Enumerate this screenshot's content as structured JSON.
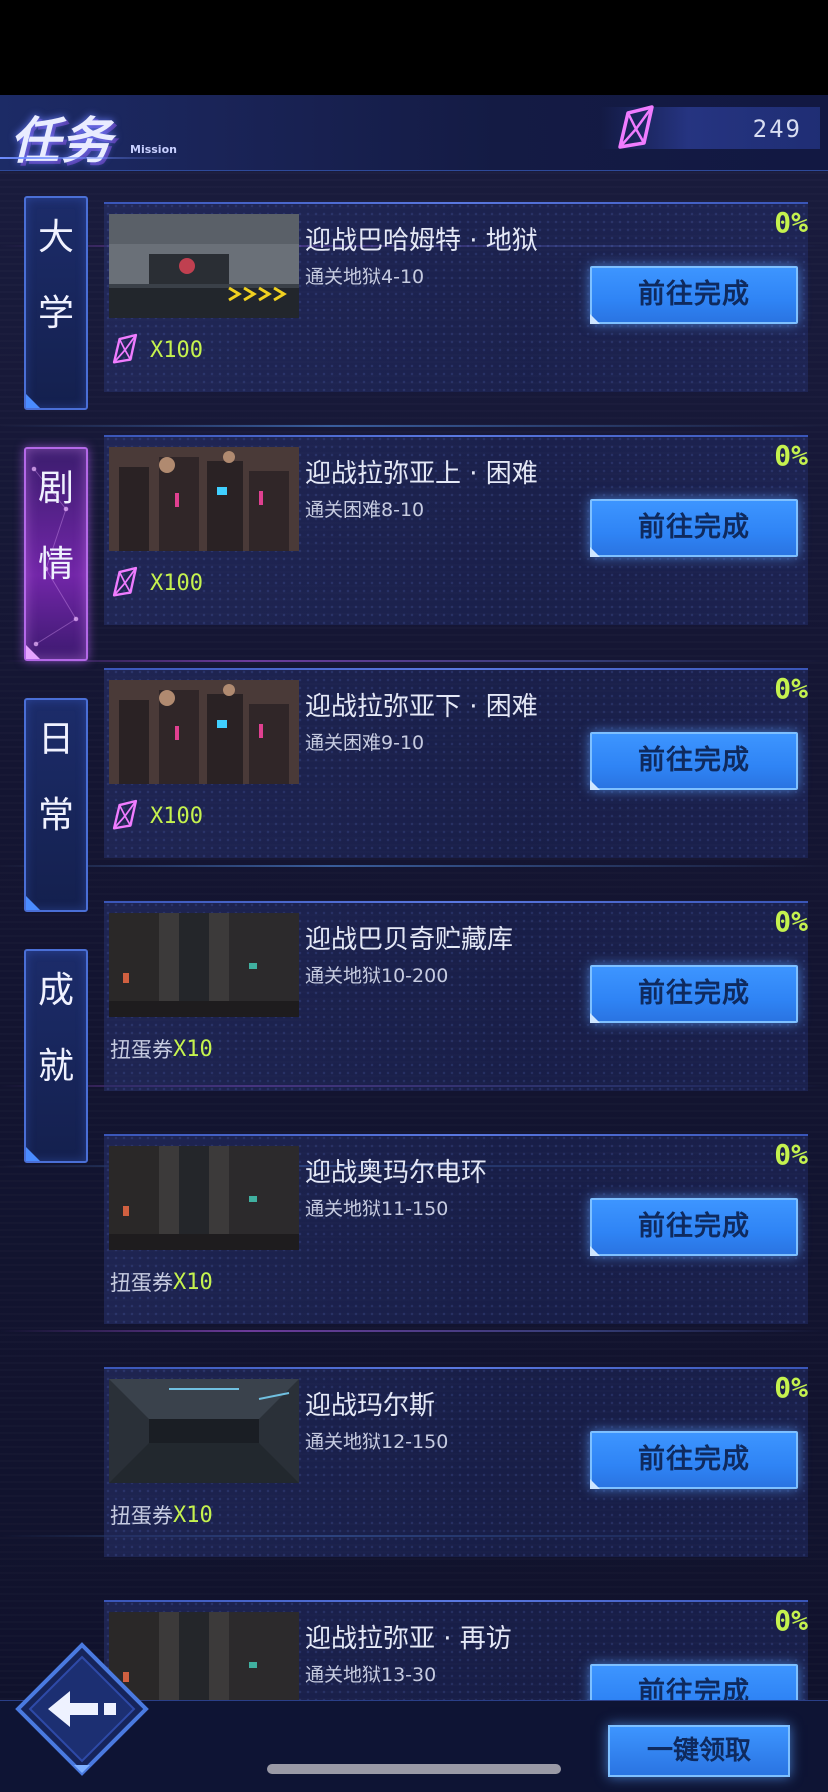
{
  "header": {
    "title": "任务",
    "subtitle": "Mission",
    "currency_value": "249",
    "currency_icon": "crystal-gem-icon"
  },
  "tabs": [
    {
      "label_top": "大",
      "label_bottom": "学",
      "active": false
    },
    {
      "label_top": "剧",
      "label_bottom": "情",
      "active": true
    },
    {
      "label_top": "日",
      "label_bottom": "常",
      "active": false
    },
    {
      "label_top": "成",
      "label_bottom": "就",
      "active": false
    }
  ],
  "tasks": [
    {
      "title": "迎战巴哈姆特 · 地狱",
      "desc": "通关地狱4-10",
      "progress": "0%",
      "button": "前往完成",
      "reward_icon": "crystal-gem-icon",
      "reward_label": "",
      "reward_qty": "X100",
      "thumb": "racing"
    },
    {
      "title": "迎战拉弥亚上 · 困难",
      "desc": "通关困难8-10",
      "progress": "0%",
      "button": "前往完成",
      "reward_icon": "crystal-gem-icon",
      "reward_label": "",
      "reward_qty": "X100",
      "thumb": "city"
    },
    {
      "title": "迎战拉弥亚下 · 困难",
      "desc": "通关困难9-10",
      "progress": "0%",
      "button": "前往完成",
      "reward_icon": "crystal-gem-icon",
      "reward_label": "",
      "reward_qty": "X100",
      "thumb": "city"
    },
    {
      "title": "迎战巴贝奇贮藏库",
      "desc": "通关地狱10-200",
      "progress": "0%",
      "button": "前往完成",
      "reward_icon": "",
      "reward_label": "扭蛋券",
      "reward_qty": "X10",
      "thumb": "alley"
    },
    {
      "title": "迎战奥玛尔电环",
      "desc": "通关地狱11-150",
      "progress": "0%",
      "button": "前往完成",
      "reward_icon": "",
      "reward_label": "扭蛋券",
      "reward_qty": "X10",
      "thumb": "alley"
    },
    {
      "title": "迎战玛尔斯",
      "desc": "通关地狱12-150",
      "progress": "0%",
      "button": "前往完成",
      "reward_icon": "",
      "reward_label": "扭蛋券",
      "reward_qty": "X10",
      "thumb": "tunnel"
    },
    {
      "title": "迎战拉弥亚 · 再访",
      "desc": "通关地狱13-30",
      "progress": "0%",
      "button": "前往完成",
      "reward_icon": "",
      "reward_label": "",
      "reward_qty": "",
      "thumb": "alley"
    }
  ],
  "footer": {
    "back_icon": "arrow-left-icon",
    "claim_all_label": "一键领取"
  },
  "colors": {
    "accent_blue": "#3d95ff",
    "progress_green": "#c5f24e",
    "active_tab_purple": "#b468e8"
  }
}
